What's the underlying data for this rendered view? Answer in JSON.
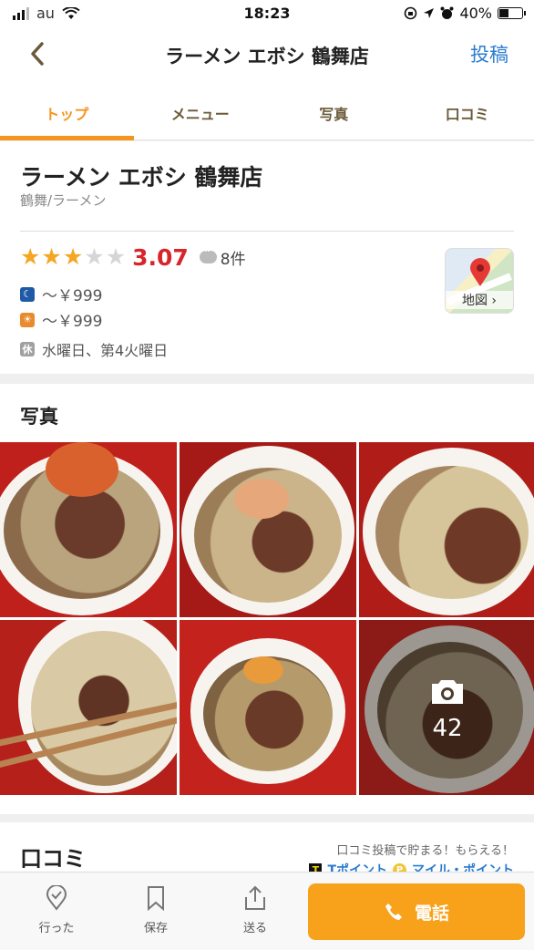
{
  "status_bar": {
    "carrier": "au",
    "time": "18:23",
    "battery": "40%",
    "battery_level": 0.4
  },
  "nav": {
    "title": "ラーメン エボシ 鶴舞店",
    "post_label": "投稿"
  },
  "tabs": [
    {
      "label": "トップ",
      "active": true
    },
    {
      "label": "メニュー",
      "active": false
    },
    {
      "label": "写真",
      "active": false
    },
    {
      "label": "口コミ",
      "active": false
    }
  ],
  "shop": {
    "name": "ラーメン エボシ 鶴舞店",
    "genre": "鶴舞/ラーメン",
    "rating": {
      "stars_filled": 3,
      "stars_total": 5,
      "score": "3.07",
      "review_count": "8件"
    },
    "dinner_price": "～￥999",
    "lunch_price": "～￥999",
    "holiday_icon": "休",
    "closed_days": "水曜日、第4火曜日",
    "map_label": "地図 ›"
  },
  "photos": {
    "section_title": "写真",
    "more_count": "42"
  },
  "reviews": {
    "section_title": "口コミ",
    "promo_text": "口コミ投稿で貯まる！もらえる！",
    "point_t": "Tポイント",
    "point_mile": "マイル・ポイント"
  },
  "bottom_bar": {
    "went_label": "行った",
    "save_label": "保存",
    "send_label": "送る",
    "call_label": "電話"
  },
  "colors": {
    "accent": "#f5951f",
    "score": "#d7262b",
    "link": "#2b7ccf",
    "call": "#f8a21b"
  }
}
